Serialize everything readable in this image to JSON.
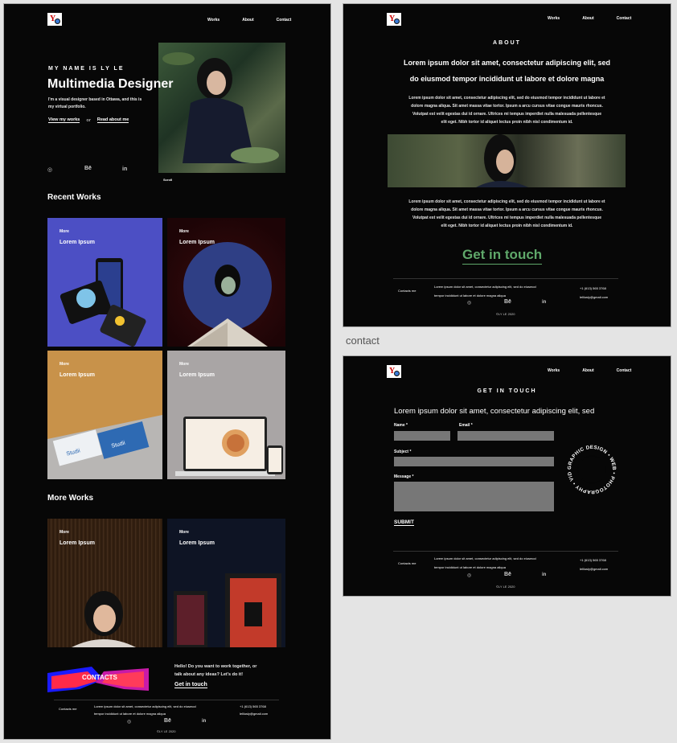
{
  "logo": {
    "letter": "Y"
  },
  "nav": {
    "works": "Works",
    "about": "About",
    "contact": "Contact"
  },
  "home": {
    "eyebrow": "MY NAME IS LY LE",
    "title": "Multimedia Designer",
    "intro_line1": "I'm a visual designer based in Ottawa, and this is",
    "intro_line2": "my virtual portfolio.",
    "view_works": "View my works",
    "or": "or",
    "read_about": "Read about me",
    "scroll": "Scroll",
    "recent_heading": "Recent Works",
    "more_heading": "More Works",
    "tiles": [
      {
        "more": "More",
        "title": "Lorem Ipsum",
        "bg": "#4c4fc4"
      },
      {
        "more": "More",
        "title": "Lorem Ipsum",
        "bg": "#2a0608"
      },
      {
        "more": "More",
        "title": "Lorem Ipsum",
        "bg": "#c8924a"
      },
      {
        "more": "More",
        "title": "Lorem Ipsum",
        "bg": "#a9a5a5"
      },
      {
        "more": "More",
        "title": "Lorem Ipsum",
        "bg": "#2a1a10"
      },
      {
        "more": "More",
        "title": "Lorem Ipsum",
        "bg": "#0e1424"
      }
    ],
    "contacts_banner": "CONTACTS",
    "hello_line1": "Hello! Do you want to work together, or",
    "hello_line2": "talk about any ideas? Let's do it!",
    "get_in_touch": "Get in touch"
  },
  "footer": {
    "contacts_me": "Contacts me",
    "lorem_line1": "Lorem ipsum dolor sit amet, consectetur adipiscing elit, sed do eiusmod",
    "lorem_line2": "tempor incididunt ut labore et dolore magna aliqua",
    "phone": "+1 (613) 565 3768",
    "email": "lelilusly@gmail.com",
    "copyright": "©LY LE 2020"
  },
  "about": {
    "eyebrow": "ABOUT",
    "headline_line1": "Lorem ipsum dolor sit amet, consectetur adipiscing elit, sed",
    "headline_line2": "do eiusmod tempor incididunt ut labore et dolore magna",
    "para1_line1": "Lorem ipsum dolor sit amet, consectetur adipiscing elit, sed do eiusmod tempor incididunt ut labore et",
    "para1_line2": "dolore magna aliqua. Sit amet massa vitae tortor. Ipsum a arcu cursus vitae congue mauris rhoncus.",
    "para1_line3": "Volutpat      est velit egestas dui id ornare. Ultrices mi tempus imperdiet nulla malesuada pellentesque",
    "para1_line4": "elit eget. Nibh tortor id aliquet lectus proin nibh nisl condimentum id.",
    "cta": "Get in touch"
  },
  "contact_caption": "contact",
  "contact": {
    "eyebrow": "GET IN TOUCH",
    "headline": "Lorem ipsum dolor sit amet, consectetur adipiscing elit, sed",
    "name_label": "Name *",
    "email_label": "Email *",
    "subject_label": "Subject *",
    "message_label": "Message *",
    "submit": "SUBMIT",
    "ring_text": "GRAPHIC DESIGN • WEB • PHOTOGRAPHY • VIDEOGRAPHY •"
  },
  "colors": {
    "background": "#070707",
    "accent_green": "#5fa86a",
    "field_gray": "#777777"
  }
}
